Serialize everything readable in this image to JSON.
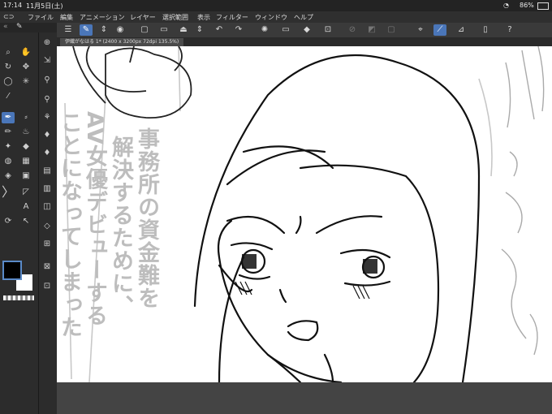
{
  "status_bar": {
    "time": "17:14",
    "date": "11月5日(土)",
    "battery": "86%"
  },
  "menu": {
    "items": [
      "ファイル",
      "編集",
      "アニメーション",
      "レイヤー",
      "選択範囲",
      "表示",
      "フィルター",
      "ウィンドウ",
      "ヘルプ"
    ]
  },
  "document_tab": {
    "label": "伊織がなはる 1* (2400 x 3200px 72dpi 135.5%)"
  },
  "canvas_text": {
    "col1": "事務所の資金難を",
    "col2": "解決するために、",
    "col3": "AV女優デビューする",
    "col4": "ことになってしまった"
  },
  "colors": {
    "accent": "#4a76b9",
    "foreground": "#000000",
    "background": "#ffffff"
  }
}
